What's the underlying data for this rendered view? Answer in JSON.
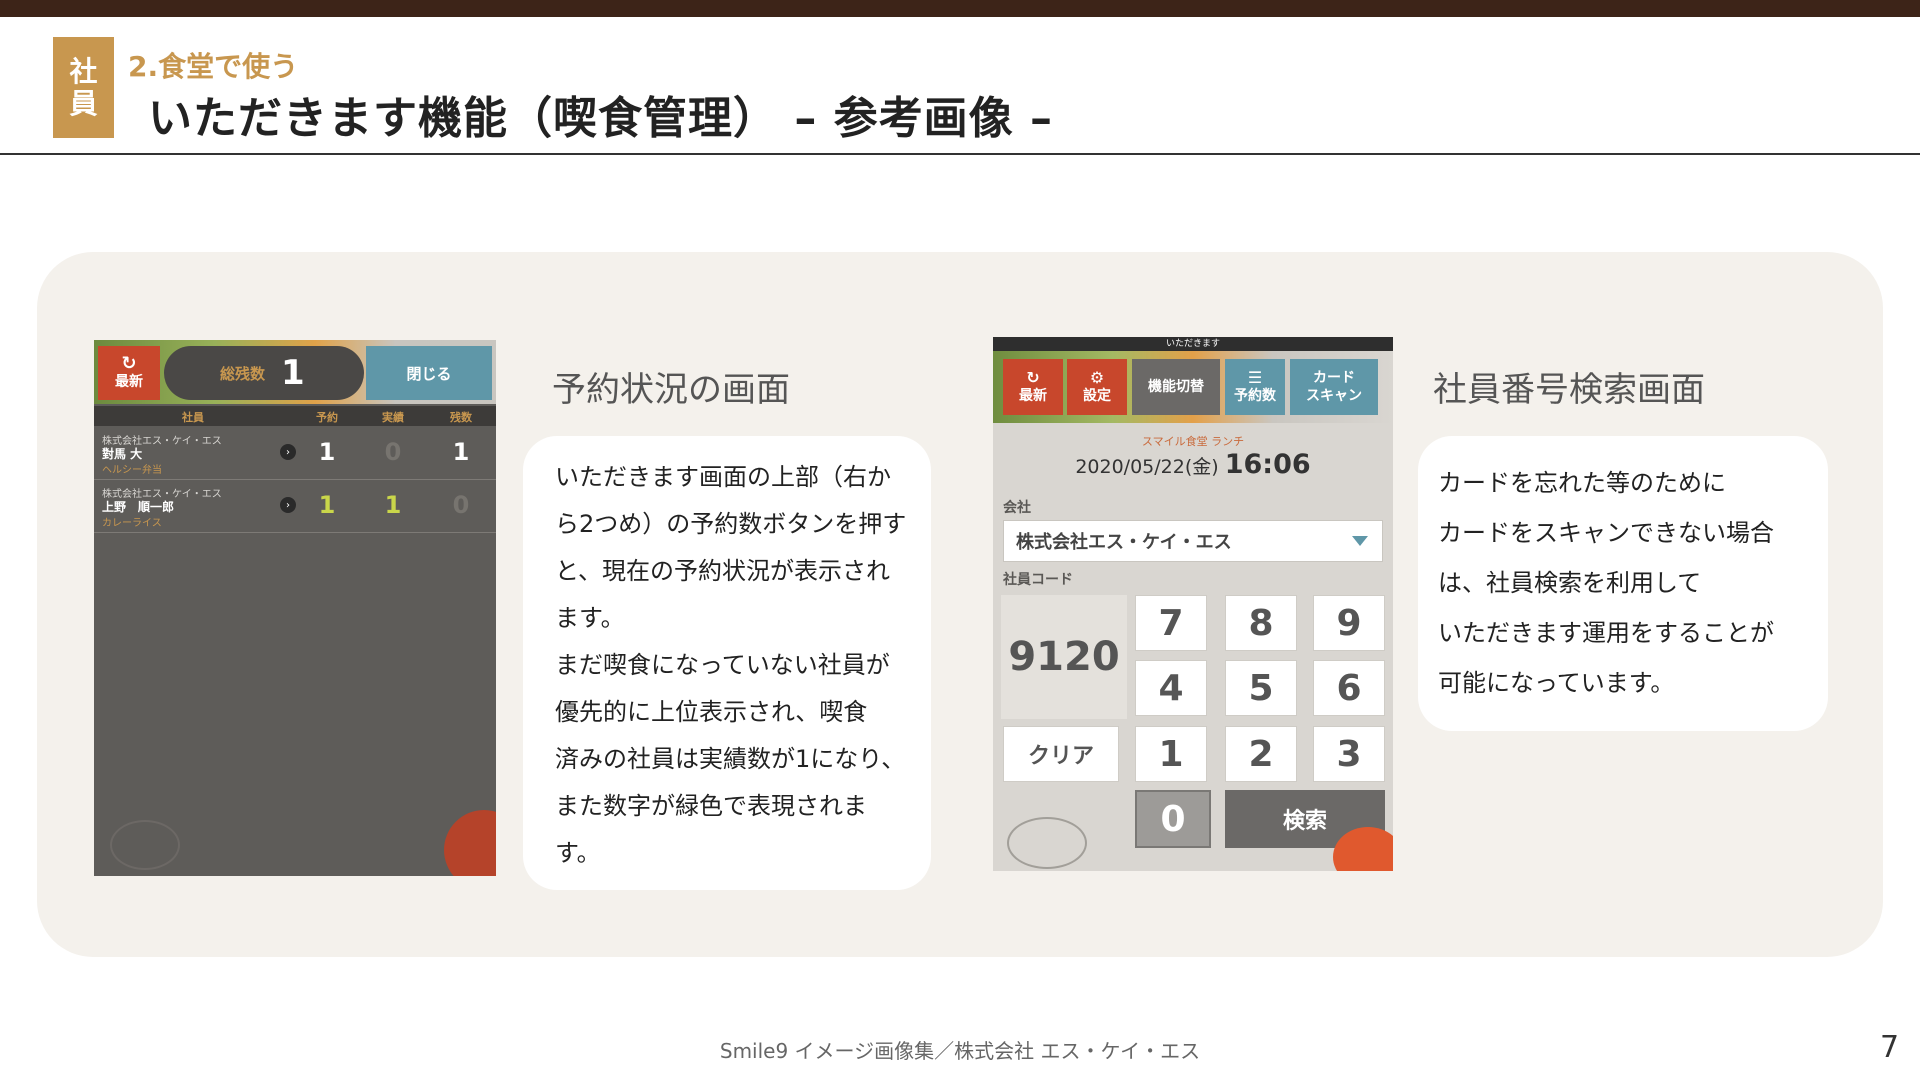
{
  "slide": {
    "tag": [
      "社",
      "員"
    ],
    "subtitle": "2.食堂で使う",
    "title": "いただきます機能（喫食管理） – 参考画像 –",
    "footer": "Smile9 イメージ画像集／株式会社 エス・ケイ・エス",
    "page_number": "7"
  },
  "colors": {
    "accent": "#c8974f",
    "topbar": "#3d2418",
    "red_button": "#c8472c",
    "teal_button": "#5f97a8",
    "green_number": "#c9d64a"
  },
  "screen1": {
    "refresh_icon": "refresh-icon",
    "refresh_label": "最新",
    "total_label": "総残数",
    "total_value": "1",
    "close_label": "閉じる",
    "columns": [
      "社員",
      "予約",
      "実績",
      "残数"
    ],
    "rows": [
      {
        "company": "株式会社エス・ケイ・エス",
        "name": "對馬 大",
        "meal": "ヘルシー弁当",
        "reserved": "1",
        "actual": "0",
        "remaining": "1"
      },
      {
        "company": "株式会社エス・ケイ・エス",
        "name": "上野　順一郎",
        "meal": "カレーライス",
        "reserved": "1",
        "actual": "1",
        "remaining": "0"
      }
    ],
    "heading": "予約状況の画面",
    "description": [
      "いただきます画面の上部（右か",
      "ら2つめ）の予約数ボタンを押す",
      "と、現在の予約状況が表示され",
      "ます。",
      "まだ喫食になっていない社員が",
      "優先的に上位表示され、喫食",
      "済みの社員は実績数が1になり、",
      "また数字が緑色で表現されま",
      "す。"
    ]
  },
  "screen2": {
    "window_title": "いただきます",
    "toolbar": {
      "refresh": "最新",
      "settings": "設定",
      "switch": "機能切替",
      "reservations": "予約数",
      "card_scan_1": "カード",
      "card_scan_2": "スキャン"
    },
    "meal_name": "スマイル食堂 ランチ",
    "date": "2020/05/22(金)",
    "time": "16:06",
    "company_label": "会社",
    "company_value": "株式会社エス・ケイ・エス",
    "code_label": "社員コード",
    "code_value": "9120",
    "keys": [
      "7",
      "8",
      "9",
      "4",
      "5",
      "6",
      "1",
      "2",
      "3",
      "0"
    ],
    "clear_label": "クリア",
    "search_label": "検索",
    "heading": "社員番号検索画面",
    "description": [
      "カードを忘れた等のために",
      "カードをスキャンできない場合",
      "は、社員検索を利用して",
      "いただきます運用をすることが",
      "可能になっています。"
    ]
  }
}
